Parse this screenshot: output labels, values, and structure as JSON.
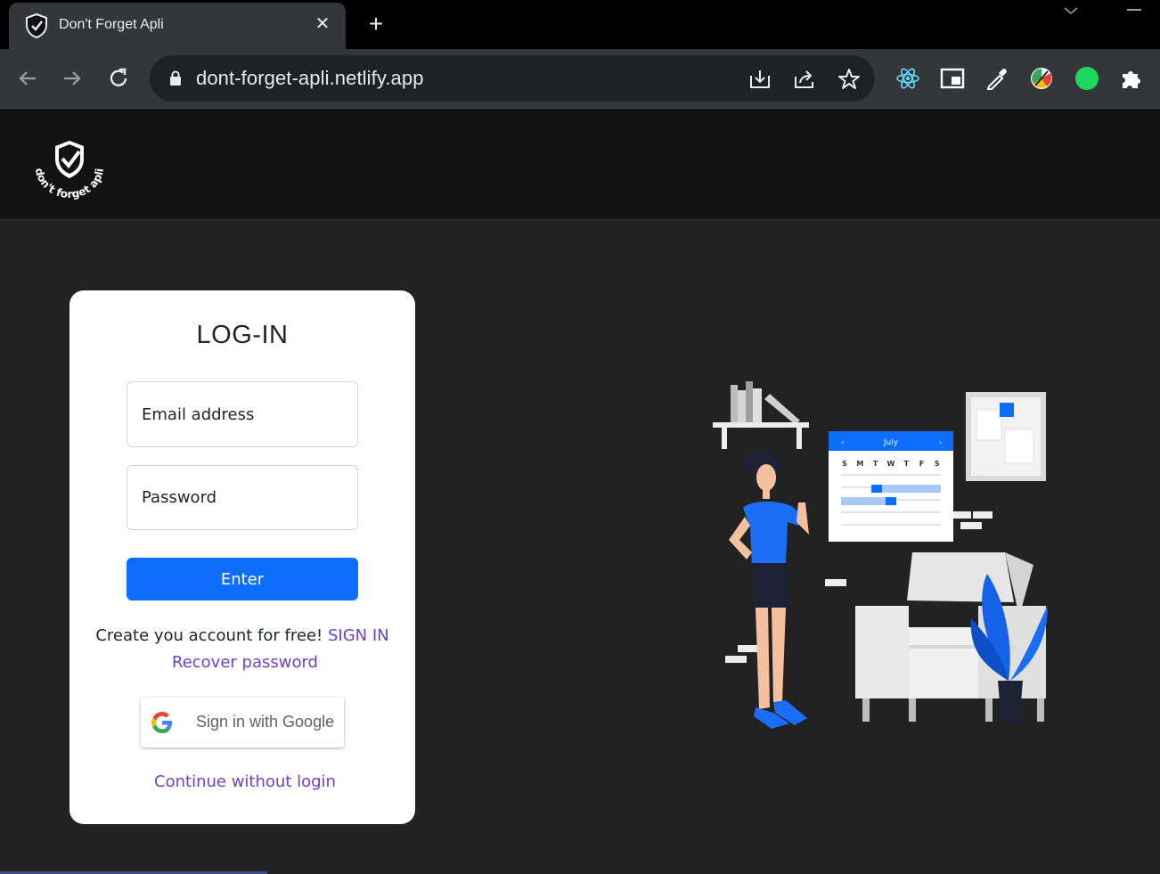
{
  "browser": {
    "tab_title": "Don't Forget Apli",
    "tab_close": "✕",
    "new_tab": "+",
    "url": "dont-forget-apli.netlify.app"
  },
  "site": {
    "logo_text": "- don't forget apli -"
  },
  "login": {
    "title": "LOG-IN",
    "email_placeholder": "Email address",
    "password_placeholder": "Password",
    "enter_label": "Enter",
    "signup_prompt": "Create you account for free! ",
    "signup_link": "SIGN IN",
    "recover_link": "Recover password",
    "google_label": "Sign in with Google",
    "continue_link": "Continue without login"
  },
  "illustration": {
    "calendar_month": "July",
    "calendar_days": [
      "S",
      "M",
      "T",
      "W",
      "T",
      "F",
      "S"
    ]
  },
  "colors": {
    "accent": "#0d6efd",
    "link": "#6f42c1",
    "page_bg": "#222222",
    "header_bg": "#121212"
  }
}
